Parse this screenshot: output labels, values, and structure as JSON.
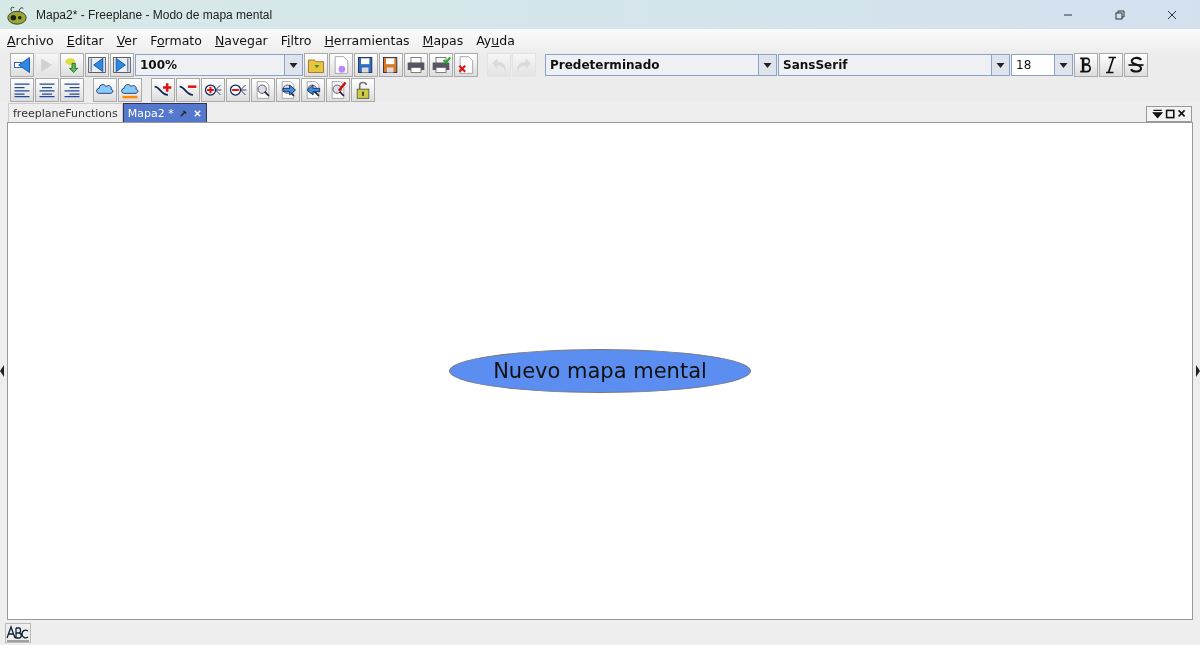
{
  "window": {
    "title": "Mapa2* - Freeplane - Modo de mapa mental"
  },
  "menu": [
    {
      "key": "A",
      "post": "rchivo"
    },
    {
      "key": "E",
      "post": "ditar"
    },
    {
      "key": "V",
      "post": "er"
    },
    {
      "pre": "F",
      "key": "o",
      "post": "rmato"
    },
    {
      "key": "N",
      "post": "avegar"
    },
    {
      "pre": "F",
      "key": "i",
      "post": "ltro"
    },
    {
      "key": "H",
      "post": "erramientas"
    },
    {
      "key": "M",
      "post": "apas"
    },
    {
      "pre": "Ay",
      "key": "u",
      "post": "da"
    }
  ],
  "toolbar_1": [
    {
      "kind": "back",
      "disabled": false
    },
    {
      "kind": "forward",
      "disabled": true
    },
    {
      "kind": "export",
      "disabled": false
    },
    {
      "kind": "first",
      "disabled": false
    },
    {
      "kind": "last",
      "disabled": false
    },
    {
      "kind": "zoom_combo",
      "value": "100%"
    },
    {
      "kind": "open",
      "disabled": false
    },
    {
      "kind": "new",
      "disabled": false
    },
    {
      "kind": "save",
      "disabled": false
    },
    {
      "kind": "saveas",
      "disabled": false
    },
    {
      "kind": "print",
      "disabled": false
    },
    {
      "kind": "preview",
      "disabled": false
    },
    {
      "kind": "close",
      "disabled": false
    },
    {
      "kind": "sep"
    },
    {
      "kind": "undo",
      "disabled": true
    },
    {
      "kind": "redo",
      "disabled": true
    },
    {
      "kind": "sep"
    },
    {
      "kind": "style_combo",
      "value": "Predeterminado"
    },
    {
      "kind": "font_combo",
      "value": "SansSerif"
    },
    {
      "kind": "size_combo",
      "value": "18"
    },
    {
      "kind": "bold",
      "disabled": false
    },
    {
      "kind": "italic",
      "disabled": false
    },
    {
      "kind": "strike",
      "disabled": false
    }
  ],
  "toolbar_2": [
    {
      "kind": "alignleft",
      "disabled": false
    },
    {
      "kind": "aligncenter",
      "disabled": false
    },
    {
      "kind": "alignright",
      "disabled": false
    },
    {
      "kind": "sep"
    },
    {
      "kind": "cloud",
      "disabled": false
    },
    {
      "kind": "cloudcolor",
      "disabled": false
    },
    {
      "kind": "sep"
    },
    {
      "kind": "addlink",
      "disabled": false
    },
    {
      "kind": "removelink",
      "disabled": false
    },
    {
      "kind": "addnode",
      "disabled": false
    },
    {
      "kind": "removenode",
      "disabled": false
    },
    {
      "kind": "find",
      "disabled": false
    },
    {
      "kind": "findnext",
      "disabled": false
    },
    {
      "kind": "findprev",
      "disabled": false
    },
    {
      "kind": "findreplace",
      "disabled": false
    },
    {
      "kind": "lock",
      "disabled": false
    }
  ],
  "tabs": [
    {
      "label": "freeplaneFunctions",
      "selected": false
    },
    {
      "label": "Mapa2 *",
      "selected": true
    }
  ],
  "map": {
    "root_node": {
      "text": "Nuevo mapa mental",
      "color": "#5b8ef0"
    }
  }
}
